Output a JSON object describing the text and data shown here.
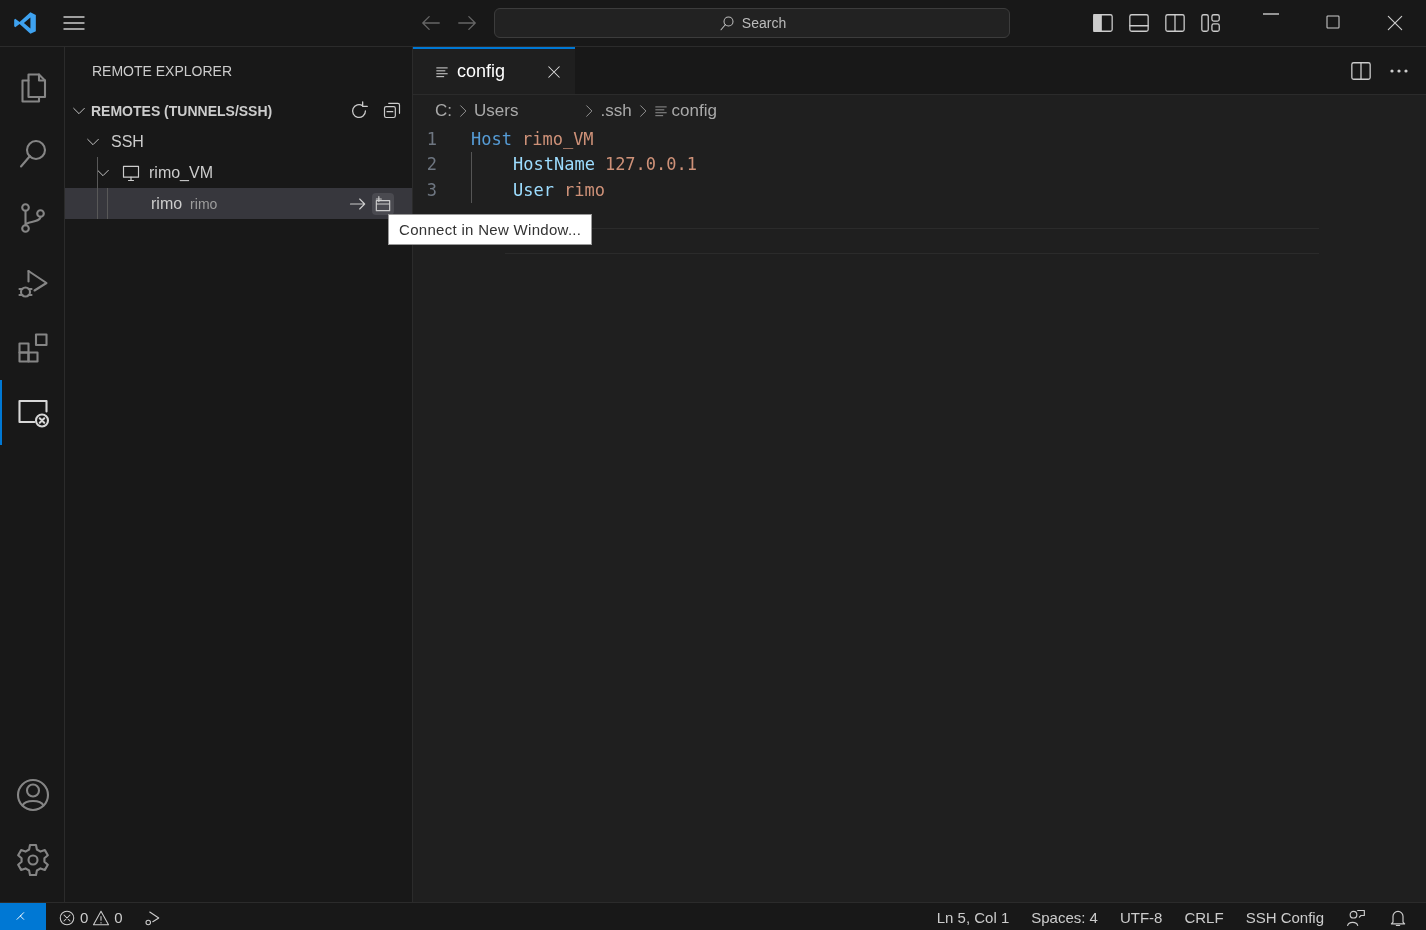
{
  "title_bar": {
    "search_placeholder": "Search"
  },
  "activity_bar": {
    "items": [
      {
        "kind": "explorer",
        "selected": false
      },
      {
        "kind": "search",
        "selected": false
      },
      {
        "kind": "source-control",
        "selected": false
      },
      {
        "kind": "run-debug",
        "selected": false
      },
      {
        "kind": "extensions",
        "selected": false
      },
      {
        "kind": "remote",
        "selected": true
      }
    ],
    "bottom": [
      {
        "kind": "accounts"
      },
      {
        "kind": "settings"
      }
    ]
  },
  "sidebar": {
    "title": "REMOTE EXPLORER",
    "section": {
      "label": "REMOTES (TUNNELS/SSH)",
      "expanded": true
    },
    "tree": [
      {
        "label": "SSH",
        "expanded": true,
        "children": [
          {
            "label": "rimo_VM",
            "kind": "host",
            "expanded": true,
            "children": [
              {
                "label": "rimo",
                "description": "rimo",
                "selected": true
              }
            ]
          }
        ]
      }
    ]
  },
  "tooltip": "Connect in New Window...",
  "editor": {
    "tabs": [
      {
        "label": "config",
        "selected": true
      }
    ],
    "breadcrumbs": [
      "C:",
      "Users",
      ".ssh",
      "config"
    ],
    "lines": [
      {
        "number": "1",
        "indented": false,
        "key": "Host",
        "value": "rimo_VM"
      },
      {
        "number": "2",
        "indented": true,
        "key": "HostName",
        "value": "127.0.0.1"
      },
      {
        "number": "3",
        "indented": true,
        "key": "User",
        "value": "rimo"
      }
    ]
  },
  "status_bar": {
    "errors": "0",
    "warnings": "0",
    "items": [
      "Ln 5, Col 1",
      "Spaces: 4",
      "UTF-8",
      "CRLF",
      "SSH Config"
    ]
  }
}
